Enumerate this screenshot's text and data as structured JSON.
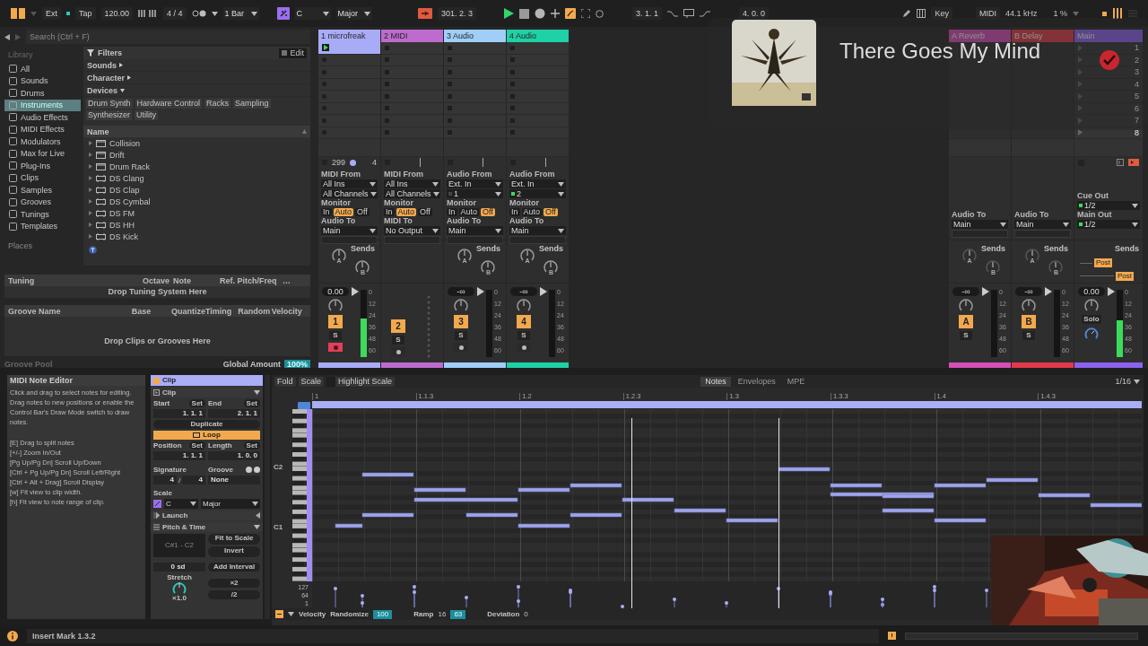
{
  "transport": {
    "sync": "Ext",
    "tap": "Tap",
    "tempo": "120.00",
    "signature": "4 / 4",
    "quantization": "1 Bar",
    "key": "C",
    "scale": "Major",
    "position": "301. 2. 3",
    "loop_start": "3. 1. 1",
    "loop_length": "4. 0. 0",
    "key_map": "Key",
    "midi_map": "MIDI",
    "sample_rate": "44.1 kHz",
    "cpu": "1 %"
  },
  "browser": {
    "search": {
      "placeholder": "Search (Ctrl + F)"
    },
    "library_title": "Library",
    "categories": [
      {
        "label": "All",
        "selected": false
      },
      {
        "label": "Sounds",
        "selected": false
      },
      {
        "label": "Drums",
        "selected": false
      },
      {
        "label": "Instruments",
        "selected": true
      },
      {
        "label": "Audio Effects",
        "selected": false
      },
      {
        "label": "MIDI Effects",
        "selected": false
      },
      {
        "label": "Modulators",
        "selected": false
      },
      {
        "label": "Max for Live",
        "selected": false
      },
      {
        "label": "Plug-Ins",
        "selected": false
      },
      {
        "label": "Clips",
        "selected": false
      },
      {
        "label": "Samples",
        "selected": false
      },
      {
        "label": "Grooves",
        "selected": false
      },
      {
        "label": "Tunings",
        "selected": false
      },
      {
        "label": "Templates",
        "selected": false
      }
    ],
    "places_title": "Places",
    "filters_title": "Filters",
    "edit": "Edit",
    "filter_groups": [
      {
        "label": "Sounds",
        "expanded": false
      },
      {
        "label": "Character",
        "expanded": false
      },
      {
        "label": "Devices",
        "expanded": true
      }
    ],
    "tags": [
      "Drum Synth",
      "Hardware Control",
      "Racks",
      "Sampling",
      "Synthesizer",
      "Utility"
    ],
    "name_column": "Name",
    "items": [
      {
        "label": "Collision",
        "kind": "device"
      },
      {
        "label": "Drift",
        "kind": "device"
      },
      {
        "label": "Drum Rack",
        "kind": "device"
      },
      {
        "label": "DS Clang",
        "kind": "drum"
      },
      {
        "label": "DS Clap",
        "kind": "drum"
      },
      {
        "label": "DS Cymbal",
        "kind": "drum"
      },
      {
        "label": "DS FM",
        "kind": "drum"
      },
      {
        "label": "DS HH",
        "kind": "drum"
      },
      {
        "label": "DS Kick",
        "kind": "drum"
      }
    ]
  },
  "tuning": {
    "columns": [
      "Tuning",
      "Octave",
      "Note",
      "Ref. Pitch/Freq",
      "…"
    ],
    "drop_hint": "Drop Tuning System Here"
  },
  "groove_pool": {
    "columns": [
      "Groove Name",
      "Base",
      "Quantize",
      "Timing",
      "Random",
      "Velocity"
    ],
    "drop_hint": "Drop Clips or Grooves Here",
    "title": "Groove Pool",
    "global_amount_label": "Global Amount",
    "global_amount": "100%"
  },
  "channels": [
    {
      "kind": "midi",
      "name": "1 microfreak",
      "color": "#a8acf7",
      "armed": true,
      "clip_playing": true,
      "clip_tempo": "299",
      "clip_bars": "4",
      "input_label": "MIDI From",
      "input": "All Ins",
      "channel": "All Channels",
      "monitor_label": "Monitor",
      "monitor": [
        {
          "label": "In",
          "selected": false
        },
        {
          "label": "Auto",
          "selected": true
        },
        {
          "label": "Off",
          "selected": false
        }
      ],
      "output_label": "Audio To",
      "output": "Main",
      "sends": {
        "title": "Sends",
        "knobs": [
          "A",
          "B"
        ]
      },
      "volume": "0.00",
      "number": "1",
      "solo": "S",
      "level": 0.58,
      "meter_scale": [
        "0",
        "12",
        "24",
        "36",
        "48",
        "60"
      ]
    },
    {
      "kind": "midi",
      "name": "2 MIDI",
      "color": "#bd6bcf",
      "armed": false,
      "clip_playing": false,
      "input_label": "MIDI From",
      "input": "All Ins",
      "channel": "All Channels",
      "monitor_label": "Monitor",
      "monitor": [
        {
          "label": "In",
          "selected": false
        },
        {
          "label": "Auto",
          "selected": true
        },
        {
          "label": "Off",
          "selected": false
        }
      ],
      "output_label": "MIDI To",
      "output": "No Output",
      "number": "2",
      "solo": "S"
    },
    {
      "kind": "audio",
      "name": "3 Audio",
      "color": "#9fcff8",
      "armed": false,
      "clip_playing": false,
      "input_label": "Audio From",
      "input": "Ext. In",
      "channel": "1",
      "channel_active": false,
      "monitor_label": "Monitor",
      "monitor": [
        {
          "label": "In",
          "selected": false
        },
        {
          "label": "Auto",
          "selected": false
        },
        {
          "label": "Off",
          "selected": true
        }
      ],
      "output_label": "Audio To",
      "output": "Main",
      "sends": {
        "title": "Sends",
        "knobs": [
          "A",
          "B"
        ]
      },
      "volume": "-∞",
      "number": "3",
      "solo": "S",
      "level": 0,
      "meter_scale": [
        "0",
        "12",
        "24",
        "36",
        "48",
        "60"
      ]
    },
    {
      "kind": "audio",
      "name": "4 Audio",
      "color": "#1fd1a6",
      "armed": false,
      "clip_playing": false,
      "input_label": "Audio From",
      "input": "Ext. In",
      "channel": "2",
      "channel_active": true,
      "monitor_label": "Monitor",
      "monitor": [
        {
          "label": "In",
          "selected": false
        },
        {
          "label": "Auto",
          "selected": false
        },
        {
          "label": "Off",
          "selected": true
        }
      ],
      "output_label": "Audio To",
      "output": "Main",
      "sends": {
        "title": "Sends",
        "knobs": [
          "A",
          "B"
        ]
      },
      "volume": "-∞",
      "number": "4",
      "solo": "S",
      "level": 0,
      "meter_scale": [
        "0",
        "12",
        "24",
        "36",
        "48",
        "60"
      ]
    },
    {
      "kind": "return",
      "name": "A Reverb",
      "color": "#d64fb8",
      "output_label": "Audio To",
      "output": "Main",
      "sends": {
        "title": "Sends",
        "knobs": [
          "A",
          "B"
        ]
      },
      "volume": "-∞",
      "number": "A",
      "solo": "S",
      "level": 0,
      "meter_scale": [
        "0",
        "12",
        "24",
        "36",
        "48",
        "60"
      ]
    },
    {
      "kind": "return",
      "name": "B Delay",
      "color": "#e23a48",
      "output_label": "Audio To",
      "output": "Main",
      "sends": {
        "title": "Sends",
        "knobs": [
          "A",
          "B"
        ]
      },
      "volume": "-∞",
      "number": "B",
      "solo": "S",
      "level": 0,
      "meter_scale": [
        "0",
        "12",
        "24",
        "36",
        "48",
        "60"
      ]
    },
    {
      "kind": "main",
      "name": "Main",
      "color": "#8c62ef",
      "scenes": [
        "1",
        "2",
        "3",
        "4",
        "5",
        "6",
        "7",
        "8"
      ],
      "cue_label": "Cue Out",
      "cue": "1/2",
      "output_label": "Main Out",
      "output": "1/2",
      "sends": {
        "title": "Sends",
        "post": [
          "Post",
          "Post"
        ]
      },
      "volume": "0.00",
      "solo": "Solo",
      "level": 0.55,
      "meter_scale": [
        "0",
        "12",
        "24",
        "36",
        "48",
        "60"
      ]
    }
  ],
  "now_playing": {
    "title": "There Goes My Mind"
  },
  "note_editor_help": {
    "title": "MIDI Note Editor",
    "text": "Click and drag to select notes for editing. Drag notes to new positions or enable the Control Bar's Draw Mode switch to draw notes.",
    "shortcuts": [
      "[E] Drag to split notes",
      "[+/-] Zoom In/Out",
      "[Pg Up/Pg Dn] Scroll Up/Down",
      "[Ctrl + Pg Up/Pg Dn] Scroll Left/Right",
      "[Ctrl + Alt + Drag] Scroll Display",
      "[w] Fit view to clip width.",
      "[h] Fit view to note range of clip."
    ]
  },
  "clip": {
    "tab": "Clip",
    "section": "Clip",
    "start": {
      "label": "Start",
      "set": "Set",
      "value": "1. 1. 1"
    },
    "end": {
      "label": "End",
      "set": "Set",
      "value": "2. 1. 1"
    },
    "duplicate": "Duplicate",
    "loop": {
      "label": "Loop",
      "on": true
    },
    "position": {
      "label": "Position",
      "set": "Set",
      "value": "1. 1. 1"
    },
    "length": {
      "label": "Length",
      "set": "Set",
      "value": "1. 0. 0"
    },
    "signature_label": "Signature",
    "signature": [
      "4",
      "4"
    ],
    "signature_separator": "/",
    "groove_label": "Groove",
    "groove": "None",
    "scale_label": "Scale",
    "scale_key": "C",
    "scale_name": "Major",
    "launch": "Launch",
    "pitch_time": "Pitch & Time",
    "range": "C#1 - C2",
    "fit_to_scale": "Fit to Scale",
    "invert": "Invert",
    "transpose": "0 sd",
    "add_interval": "Add Interval",
    "stretch_label": "Stretch",
    "stretch": "×1.0",
    "double": "×2",
    "half": "/2"
  },
  "piano_roll": {
    "tools": [
      "Fold",
      "Scale",
      "Highlight Scale"
    ],
    "tabs": [
      {
        "label": "Notes",
        "selected": true
      },
      {
        "label": "Envelopes",
        "selected": false
      },
      {
        "label": "MPE",
        "selected": false
      }
    ],
    "grid": "1/16",
    "ruler": [
      "1",
      "1.1.3",
      "1.2",
      "1.2.3",
      "1.3",
      "1.3.3",
      "1.4",
      "1.4.3"
    ],
    "octaves": [
      "C2",
      "C1"
    ],
    "velocity_ticks": [
      "127",
      "64",
      "1"
    ],
    "footer": {
      "velocity": "Velocity",
      "randomize": "Randomize",
      "randomize_value": "100",
      "ramp": "Ramp",
      "ramp_start": "16",
      "ramp_end": "63",
      "deviation": "Deviation",
      "deviation_value": "0"
    }
  },
  "status": {
    "message": "Insert Mark 1.3.2"
  }
}
